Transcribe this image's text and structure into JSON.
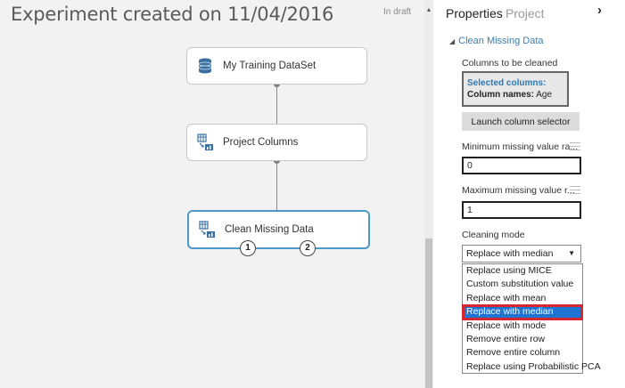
{
  "canvas": {
    "title": "Experiment created on 11/04/2016",
    "status": "In draft",
    "modules": [
      {
        "label": "My Training DataSet"
      },
      {
        "label": "Project Columns"
      },
      {
        "label": "Clean Missing Data"
      }
    ],
    "ports": [
      "1",
      "2"
    ]
  },
  "panel": {
    "tabs": [
      "Properties",
      "Project"
    ],
    "close_glyph": "›",
    "section_title": "Clean Missing Data",
    "columns_label": "Columns to be cleaned",
    "selected_title": "Selected columns:",
    "column_names_label": "Column names:",
    "column_names_value": "Age",
    "launch_button": "Launch column selector",
    "min_label": "Minimum missing value ra...",
    "min_value": "0",
    "max_label": "Maximum missing value r...",
    "max_value": "1",
    "cleaning_mode_label": "Cleaning mode",
    "cleaning_mode_selected": "Replace with median",
    "options": [
      "Replace using MICE",
      "Custom substitution value",
      "Replace with mean",
      "Replace with median",
      "Replace with mode",
      "Remove entire row",
      "Remove entire column",
      "Replace using Probabilistic PCA"
    ],
    "active_option_index": 3
  },
  "colors": {
    "accent_blue": "#4c9ac9",
    "link_blue": "#3a7fb0",
    "selected_option_bg": "#1f73d1",
    "highlight_red": "#d6262f"
  }
}
